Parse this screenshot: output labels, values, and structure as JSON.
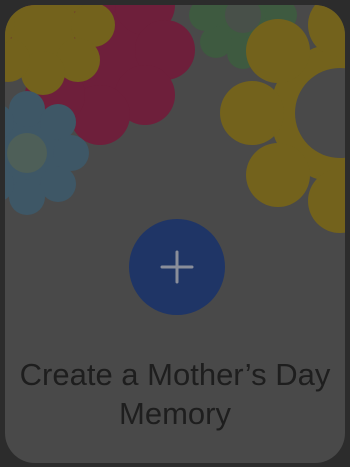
{
  "card": {
    "title": "Create a Mother’s Day Memory",
    "add_icon": "plus-icon",
    "decoration_icons": [
      "flower-icon"
    ]
  },
  "colors": {
    "page_background": "#2c2c2c",
    "card_background": "#494949",
    "button": "#1f3566",
    "plus": "#8a8e9a",
    "title_text": "#1e1e1e",
    "flower_yellow": "#73621c",
    "flower_magenta": "#6e1f3b",
    "flower_blue": "#3e5766",
    "flower_green": "#3e5a40"
  }
}
